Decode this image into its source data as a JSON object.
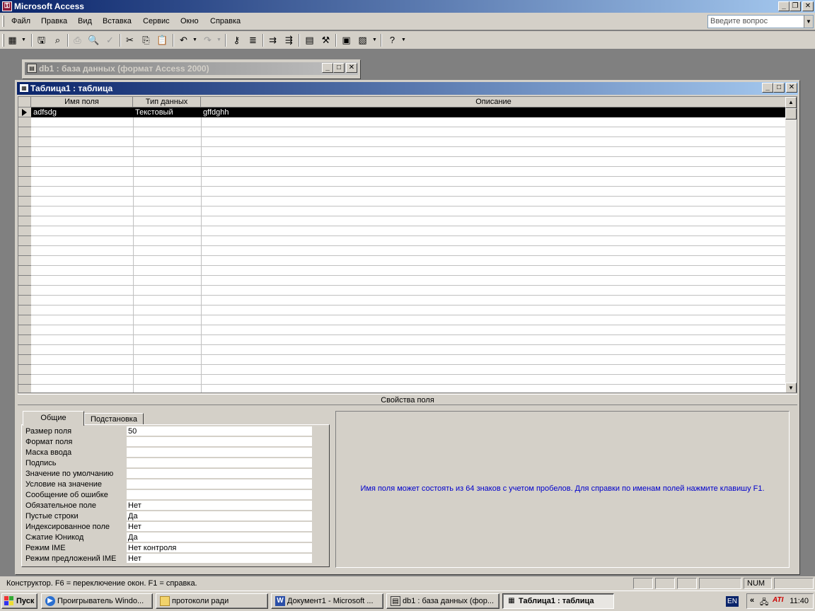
{
  "app": {
    "title": "Microsoft Access",
    "icon": "key-icon"
  },
  "menu": [
    "Файл",
    "Правка",
    "Вид",
    "Вставка",
    "Сервис",
    "Окно",
    "Справка"
  ],
  "ask_box": {
    "placeholder": "Введите вопрос"
  },
  "db_window": {
    "title": "db1 : база данных (формат Access 2000)"
  },
  "table_window": {
    "title": "Таблица1 : таблица"
  },
  "grid": {
    "columns": [
      "Имя поля",
      "Тип данных",
      "Описание"
    ],
    "rows": [
      {
        "name": "adfsdg",
        "type": "Текстовый",
        "description": "gffdghh",
        "selected": true
      }
    ]
  },
  "properties": {
    "title": "Свойства поля",
    "tabs": [
      "Общие",
      "Подстановка"
    ],
    "active_tab": "Общие",
    "rows": [
      {
        "label": "Размер поля",
        "value": "50"
      },
      {
        "label": "Формат поля",
        "value": ""
      },
      {
        "label": "Маска ввода",
        "value": ""
      },
      {
        "label": "Подпись",
        "value": ""
      },
      {
        "label": "Значение по умолчанию",
        "value": ""
      },
      {
        "label": "Условие на значение",
        "value": ""
      },
      {
        "label": "Сообщение об ошибке",
        "value": ""
      },
      {
        "label": "Обязательное поле",
        "value": "Нет"
      },
      {
        "label": "Пустые строки",
        "value": "Да"
      },
      {
        "label": "Индексированное поле",
        "value": "Нет"
      },
      {
        "label": "Сжатие Юникод",
        "value": "Да"
      },
      {
        "label": "Режим IME",
        "value": "Нет контроля"
      },
      {
        "label": "Режим предложений IME",
        "value": "Нет"
      }
    ],
    "help_text": "Имя поля может состоять из 64 знаков с учетом пробелов.  Для справки по именам полей нажмите клавишу F1."
  },
  "status": {
    "text": "Конструктор.  F6 = переключение окон.  F1 = справка.",
    "num": "NUM"
  },
  "taskbar": {
    "start": "Пуск",
    "tasks": [
      {
        "label": "Проигрыватель Windo...",
        "icon": "media-player-icon"
      },
      {
        "label": "протоколи ради",
        "icon": "folder-icon"
      },
      {
        "label": "Документ1 - Microsoft ...",
        "icon": "word-icon"
      },
      {
        "label": "db1 : база данных (фор...",
        "icon": "database-icon"
      },
      {
        "label": "Таблица1 : таблица",
        "icon": "table-icon",
        "active": true
      }
    ],
    "lang": "EN",
    "clock": "11:40"
  }
}
